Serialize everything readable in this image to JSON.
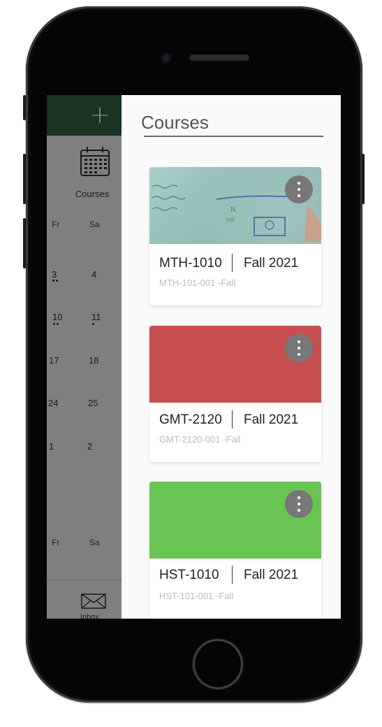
{
  "app": {
    "drawer_title": "Courses"
  },
  "nav": {
    "courses_label": "Courses",
    "inbox_label": "Inbox"
  },
  "calendar": {
    "day_heads": [
      "Fr",
      "Sa"
    ],
    "weeks": [
      [
        "3",
        "4"
      ],
      [
        "10",
        "11"
      ],
      [
        "17",
        "18"
      ],
      [
        "24",
        "25"
      ],
      [
        "1",
        "2"
      ]
    ],
    "day_heads_bottom": [
      "Fr",
      "Sa"
    ]
  },
  "courses": [
    {
      "code": "MTH-1010",
      "term": "Fall 2021",
      "section": "MTH-101-001 -Fall",
      "banner": "image"
    },
    {
      "code": "GMT-2120",
      "term": "Fall 2021",
      "section": "GMT-2120-001 -Fall",
      "banner_color": "#c64f4f"
    },
    {
      "code": "HST-1010",
      "term": "Fall 2021",
      "section": "HST-101-001 -Fall",
      "banner_color": "#69c453"
    }
  ],
  "colors": {
    "brand_green": "#2e6b44",
    "more_button": "#777777"
  },
  "icons": {
    "add": "plus-icon",
    "calendar": "calendar-icon",
    "mail": "mail-icon",
    "more": "more-vert-icon"
  }
}
